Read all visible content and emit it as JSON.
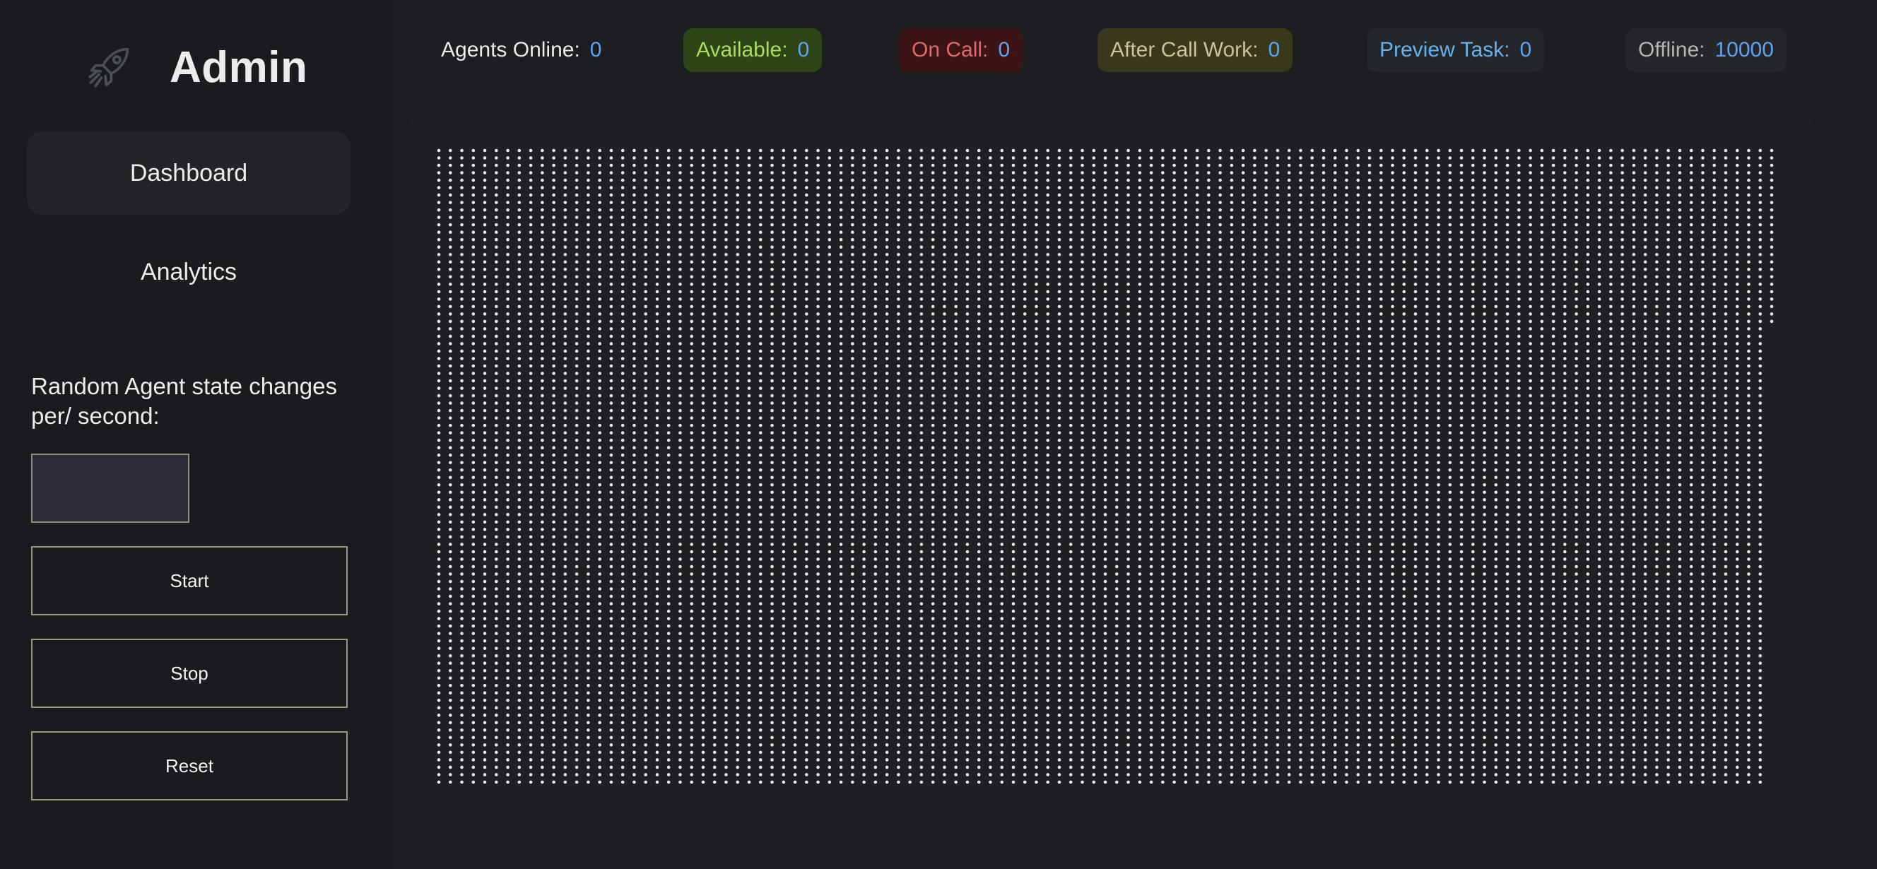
{
  "sidebar": {
    "brand_title": "Admin",
    "logo_icon": "rocket-icon",
    "nav": {
      "dashboard_label": "Dashboard",
      "analytics_label": "Analytics"
    },
    "controls": {
      "rate_label": "Random Agent state changes per/ second:",
      "rate_input_value": "",
      "start_label": "Start",
      "stop_label": "Stop",
      "reset_label": "Reset"
    }
  },
  "status_bar": {
    "online": {
      "label": "Agents Online:",
      "value": "0"
    },
    "available": {
      "label": "Available:",
      "value": "0"
    },
    "on_call": {
      "label": "On Call:",
      "value": "0"
    },
    "after_call_work": {
      "label": "After Call Work:",
      "value": "0"
    },
    "preview_task": {
      "label": "Preview Task:",
      "value": "0"
    },
    "offline": {
      "label": "Offline:",
      "value": "10000"
    }
  },
  "agent_grid": {
    "total_agents": 10000,
    "state": "offline",
    "colors": {
      "offline_dot": "#e8e8e8",
      "available": "#a7dd60",
      "on_call": "#e06a6a",
      "after_call_work": "#c9c29a",
      "preview_task": "#66b2ee",
      "value_accent": "#5fa2f0"
    }
  }
}
